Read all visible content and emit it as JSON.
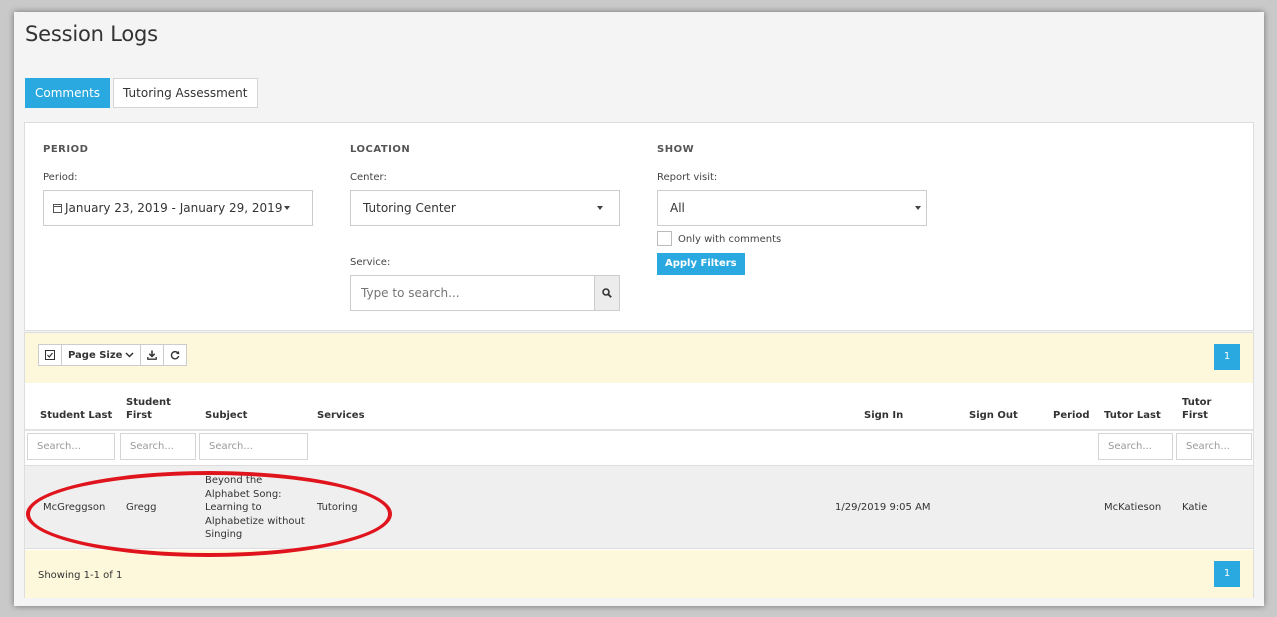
{
  "page": {
    "title": "Session Logs"
  },
  "tabs": [
    {
      "label": "Comments",
      "active": true
    },
    {
      "label": "Tutoring Assessment",
      "active": false
    }
  ],
  "filters": {
    "period": {
      "heading": "PERIOD",
      "label": "Period:",
      "value": "January 23, 2019 - January 29, 2019"
    },
    "location": {
      "heading": "LOCATION",
      "center_label": "Center:",
      "center_value": "Tutoring Center",
      "service_label": "Service:",
      "service_placeholder": "Type to search..."
    },
    "show": {
      "heading": "SHOW",
      "report_label": "Report visit:",
      "report_value": "All",
      "only_comments_label": "Only with comments",
      "only_comments_checked": false,
      "apply_label": "Apply Filters"
    }
  },
  "toolbar": {
    "page_size_label": "Page Size",
    "page": "1"
  },
  "table": {
    "columns": [
      {
        "line1": "Student Last",
        "line2": ""
      },
      {
        "line1": "Student",
        "line2": "First"
      },
      {
        "line1": "Subject",
        "line2": ""
      },
      {
        "line1": "Services",
        "line2": ""
      },
      {
        "line1": "Sign In",
        "line2": ""
      },
      {
        "line1": "Sign Out",
        "line2": ""
      },
      {
        "line1": "Period",
        "line2": ""
      },
      {
        "line1": "Tutor Last",
        "line2": ""
      },
      {
        "line1": "Tutor",
        "line2": "First"
      }
    ],
    "search_placeholder": "Search...",
    "rows": [
      {
        "student_last": "McGreggson",
        "student_first": "Gregg",
        "subject_lines": [
          "Beyond the",
          "Alphabet Song:",
          "Learning to",
          "Alphabetize without",
          "Singing"
        ],
        "services": "Tutoring",
        "sign_in": "1/29/2019 9:05 AM",
        "sign_out": "",
        "period": "",
        "tutor_last": "McKatieson",
        "tutor_first": "Katie"
      }
    ]
  },
  "footer": {
    "showing": "Showing 1-1 of 1",
    "page": "1"
  },
  "colors": {
    "accent": "#2aa9e0",
    "highlight_ellipse": "#e0141c",
    "toolbar_bg": "#fdf8dc"
  }
}
